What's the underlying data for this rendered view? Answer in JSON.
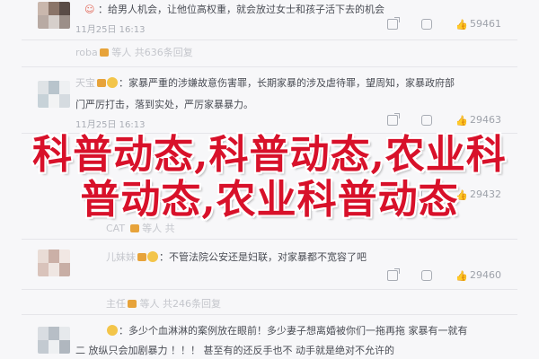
{
  "overlay": {
    "line1": "科普动态,科普动态,农业科",
    "line2": "普动态,农业科普动态"
  },
  "comments": [
    {
      "name": "",
      "text": "：给男人机会，让他位高权重，就会放过女士和孩子活下去的机会",
      "time": "11月25日 16:13",
      "via": "",
      "shares": "",
      "comments": "",
      "likes": "59461"
    },
    {
      "name": "roba",
      "rank": "等人 共636条回复",
      "text": "",
      "time": "",
      "via": "",
      "shares": "",
      "comments": "",
      "likes": ""
    },
    {
      "name": "天宝",
      "text": "：家暴严重的涉嫌故意伤害罪，长期家暴的涉及虐待罪，望周知，家暴政府部",
      "text2": "门严厉打击，落到实处，严厉家暴暴力。",
      "time": "11月25日 16:13",
      "via": "",
      "shares": "",
      "comments": "",
      "likes": "29463"
    },
    {
      "name": "",
      "rank": "等人 共",
      "text": "",
      "time": "",
      "shares": "",
      "comments": "",
      "likes": "29432"
    },
    {
      "name": "CAT",
      "rank": "等人 共",
      "text": "",
      "time": "",
      "shares": "",
      "comments": "",
      "likes": ""
    },
    {
      "name": "儿妹妹",
      "text": "：不管法院公安还是妇联，对家暴都不宽容了吧",
      "time": "11月25日 16:13",
      "via": "",
      "shares": "",
      "comments": "",
      "likes": "29460"
    },
    {
      "name": "主任",
      "rank": "等人 共246条回复",
      "text": "",
      "time": "",
      "shares": "",
      "comments": "",
      "likes": ""
    },
    {
      "name": "",
      "text": "：多少个血淋淋的案例放在眼前！多少妻子想离婚被你们一拖再拖 家暴有一就有",
      "text2": "二 放纵只会加剧暴力 ！！！ 甚至有的还反手也不 动手就是绝对不允许的",
      "time": "",
      "shares": "",
      "comments": "",
      "likes": ""
    }
  ],
  "colors": {
    "overlay_red": "#d8112a",
    "link_blue": "#5b7fb8",
    "meta_gray": "#a9adb5"
  }
}
